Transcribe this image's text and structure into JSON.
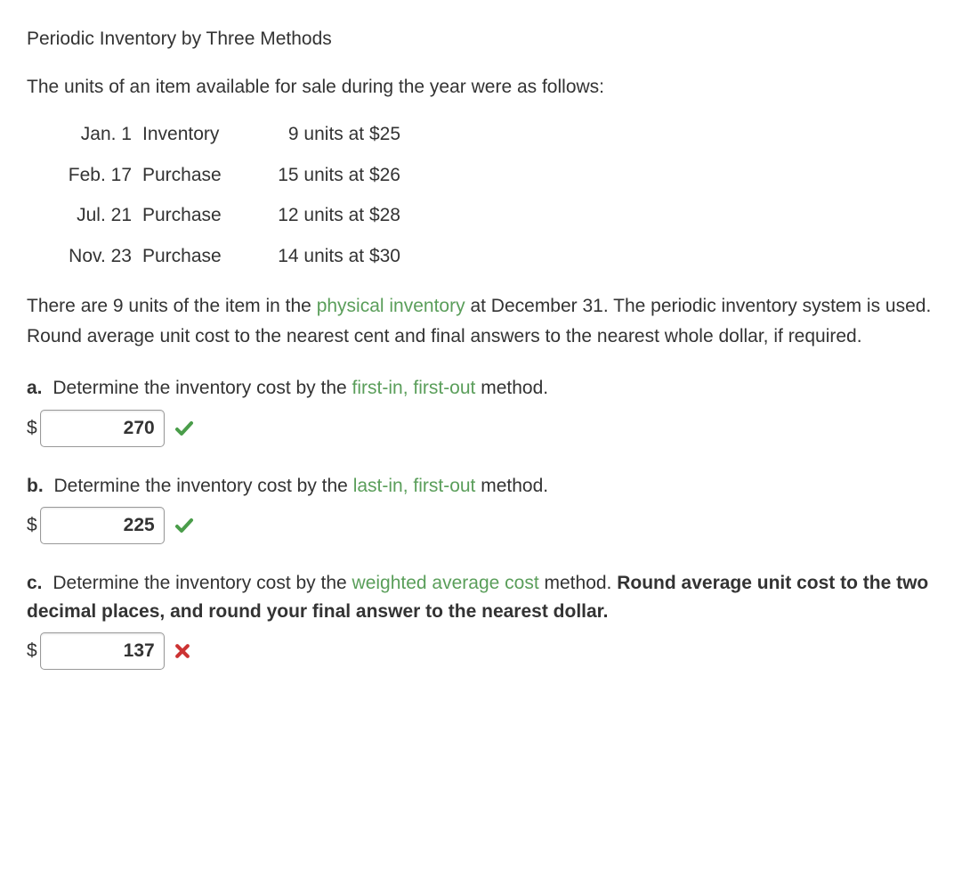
{
  "title": "Periodic Inventory by Three Methods",
  "intro": "The units of an item available for sale during the year were as follows:",
  "units": [
    {
      "date": "Jan. 1",
      "type": "Inventory",
      "desc": "9 units at $25"
    },
    {
      "date": "Feb. 17",
      "type": "Purchase",
      "desc": "15 units at $26"
    },
    {
      "date": "Jul. 21",
      "type": "Purchase",
      "desc": "12 units at $28"
    },
    {
      "date": "Nov. 23",
      "type": "Purchase",
      "desc": "14 units at $30"
    }
  ],
  "paragraph": {
    "pre": "There are 9 units of the item in the ",
    "term": "physical inventory",
    "post": " at December 31. The periodic inventory system is used. Round average unit cost to the nearest cent and final answers to the nearest whole dollar, if required."
  },
  "qa": {
    "label": "a.",
    "pre": "Determine the inventory cost by the ",
    "term": "first-in, first-out",
    "post": " method.",
    "dollar": "$",
    "value": "270",
    "status": "correct"
  },
  "qb": {
    "label": "b.",
    "pre": "Determine the inventory cost by the ",
    "term": "last-in, first-out",
    "post": " method.",
    "dollar": "$",
    "value": "225",
    "status": "correct"
  },
  "qc": {
    "label": "c.",
    "pre": "Determine the inventory cost by the ",
    "term": "weighted average cost",
    "post": " method. ",
    "bold": "Round average unit cost to the two decimal places, and round your final answer to the nearest dollar.",
    "dollar": "$",
    "value": "137",
    "status": "incorrect"
  }
}
